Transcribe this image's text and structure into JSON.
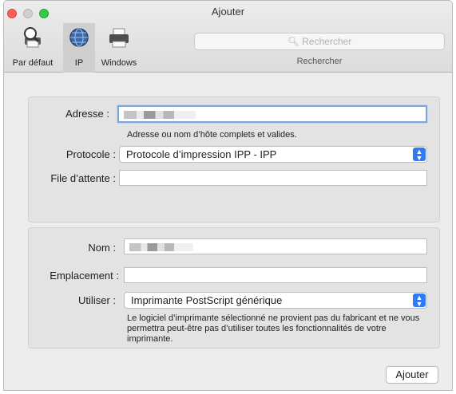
{
  "window": {
    "title": "Ajouter"
  },
  "toolbar": {
    "tabs": [
      {
        "label": "Par défaut",
        "icon": "printer-icon"
      },
      {
        "label": "IP",
        "icon": "globe-icon"
      },
      {
        "label": "Windows",
        "icon": "windows-printer-icon"
      }
    ],
    "search": {
      "placeholder": "Rechercher",
      "caption": "Rechercher"
    }
  },
  "form": {
    "address": {
      "label": "Adresse :",
      "value": "",
      "hint": "Adresse ou nom d’hôte complets et valides."
    },
    "protocol": {
      "label": "Protocole :",
      "value": "Protocole d’impression IPP - IPP"
    },
    "queue": {
      "label": "File d’attente :",
      "value": ""
    },
    "name": {
      "label": "Nom :",
      "value": ""
    },
    "location": {
      "label": "Emplacement :",
      "value": ""
    },
    "use": {
      "label": "Utiliser :",
      "value": "Imprimante PostScript générique",
      "note": "Le logiciel d’imprimante sélectionné ne provient pas du fabricant et ne vous permettra peut-être pas d’utiliser toutes les fonctionnalités de votre imprimante."
    }
  },
  "actions": {
    "add_label": "Ajouter"
  },
  "colors": {
    "accent": "#2f7bf5",
    "close": "#fc5f57",
    "zoom": "#35c84a"
  }
}
